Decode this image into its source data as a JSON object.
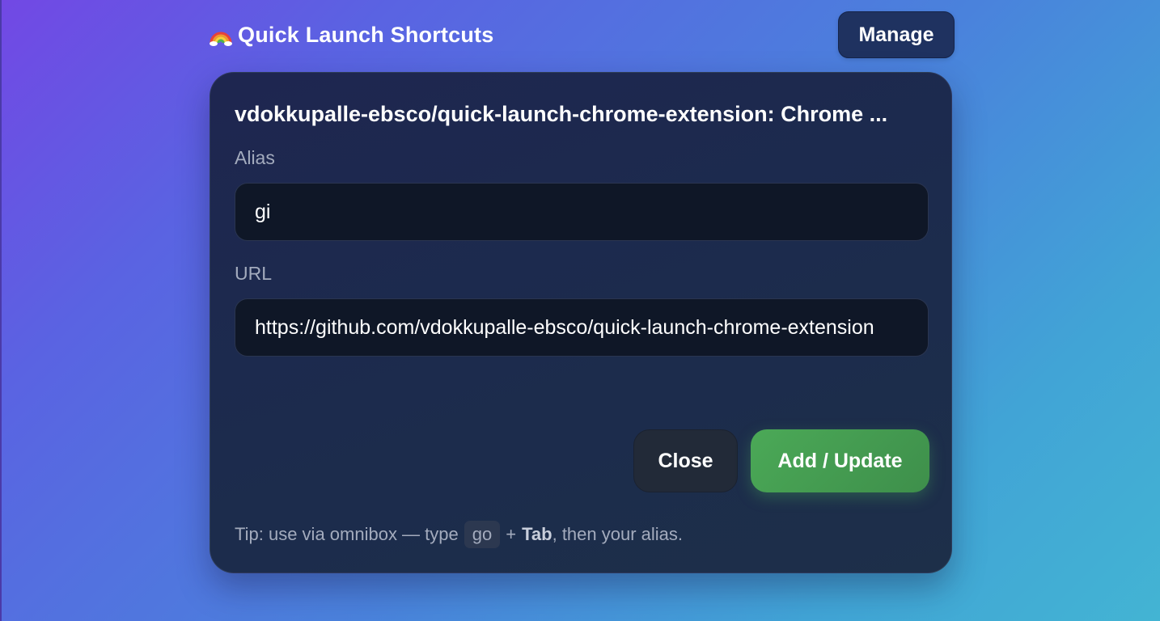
{
  "app": {
    "title": "Quick Launch Shortcuts",
    "icon": "rainbow-icon"
  },
  "header": {
    "manage_label": "Manage"
  },
  "form": {
    "page_title": "vdokkupalle-ebsco/quick-launch-chrome-extension: Chrome ...",
    "alias_label": "Alias",
    "alias_value": "gi",
    "url_label": "URL",
    "url_value": "https://github.com/vdokkupalle-ebsco/quick-launch-chrome-extension"
  },
  "actions": {
    "close_label": "Close",
    "add_update_label": "Add / Update"
  },
  "tip": {
    "prefix": "Tip: use via omnibox — type",
    "keyword": "go",
    "plus": "+",
    "key": "Tab",
    "suffix": ", then your alias."
  },
  "colors": {
    "card_background": "#1c2b4d",
    "input_background": "#0f1727",
    "manage_button": "#1f3260",
    "close_button": "#222a38",
    "add_update_button": "#46a052",
    "label_text": "#a3abbd"
  }
}
